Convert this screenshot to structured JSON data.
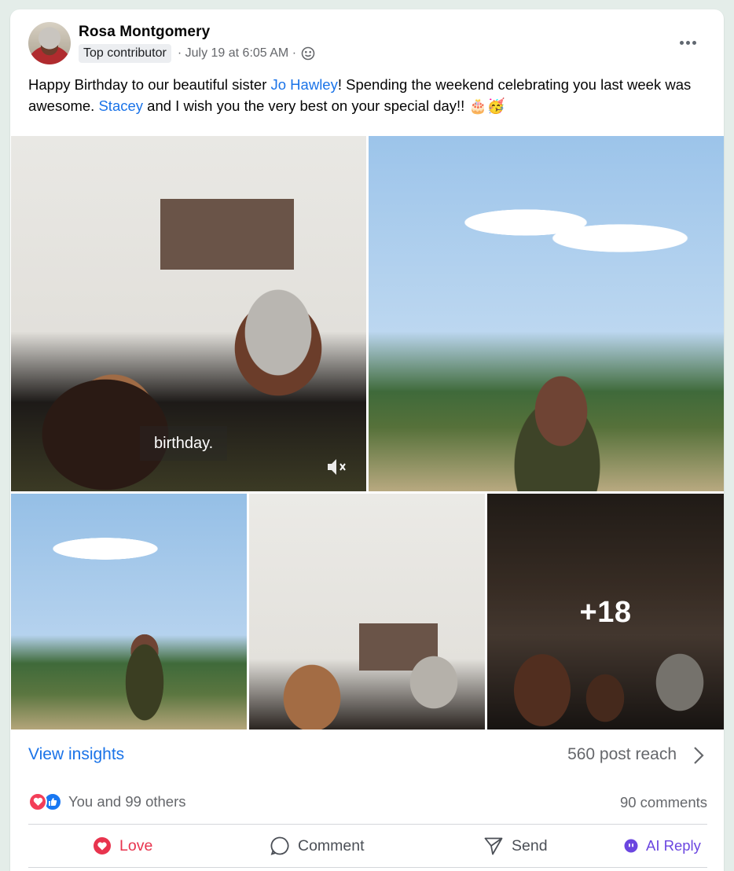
{
  "post": {
    "author": "Rosa Montgomery",
    "badge": "Top contributor",
    "meta": "· July 19 at 6:05 AM ·",
    "text": {
      "part1": "Happy Birthday to our beautiful sister ",
      "mention1": "Jo Hawley",
      "part2": "! Spending the weekend celebrating you last week was awesome. ",
      "mention2": "Stacey",
      "part3": " and I wish you the very best on your special day!! 🎂🥳"
    }
  },
  "media": {
    "video_caption": "birthday.",
    "more_count": "+18"
  },
  "insights": {
    "link": "View insights",
    "reach": "560 post reach"
  },
  "reactions": {
    "summary": "You and 99 others",
    "comments": "90 comments"
  },
  "actions": {
    "love": "Love",
    "comment": "Comment",
    "send": "Send",
    "ai_reply": "AI Reply"
  },
  "colors": {
    "link_blue": "#1a73e8",
    "love_red": "#e8344e",
    "ai_purple": "#6b46e0",
    "background": "#e4ede9"
  }
}
